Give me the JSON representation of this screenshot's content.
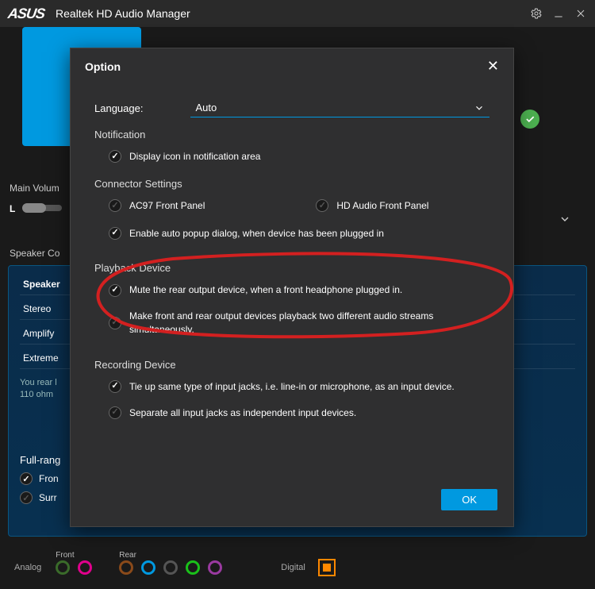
{
  "titlebar": {
    "logo": "ASUS",
    "title": "Realtek HD Audio Manager"
  },
  "main": {
    "volume_label": "Main Volum",
    "l_label": "L",
    "speaker_tab": "Speaker Co"
  },
  "tabs": {
    "items": [
      {
        "label": "Speaker"
      },
      {
        "label": "Stereo"
      },
      {
        "label": "Amplify"
      },
      {
        "label": "Extreme"
      }
    ],
    "hint_line1": "You rear l",
    "hint_line2": "110 ohm",
    "full_range": "Full-rang",
    "front": "Fron",
    "surr": "Surr"
  },
  "dialog": {
    "title": "Option",
    "language_label": "Language:",
    "language_value": "Auto",
    "notification_label": "Notification",
    "notification_check": "Display icon in notification area",
    "connector_label": "Connector Settings",
    "ac97": "AC97 Front Panel",
    "hd_audio": "HD Audio Front Panel",
    "auto_popup": "Enable auto popup dialog, when device has been plugged in",
    "playback_label": "Playback Device",
    "mute_rear": "Mute the rear output device, when a front headphone plugged in.",
    "two_streams": "Make front and rear output devices playback two different audio streams simultaneously.",
    "recording_label": "Recording Device",
    "tie_up": "Tie up same type of input jacks, i.e. line-in or microphone, as an input device.",
    "separate": "Separate all input jacks as independent input devices.",
    "ok": "OK"
  },
  "footer": {
    "analog": "Analog",
    "front": "Front",
    "rear": "Rear",
    "digital": "Digital"
  }
}
